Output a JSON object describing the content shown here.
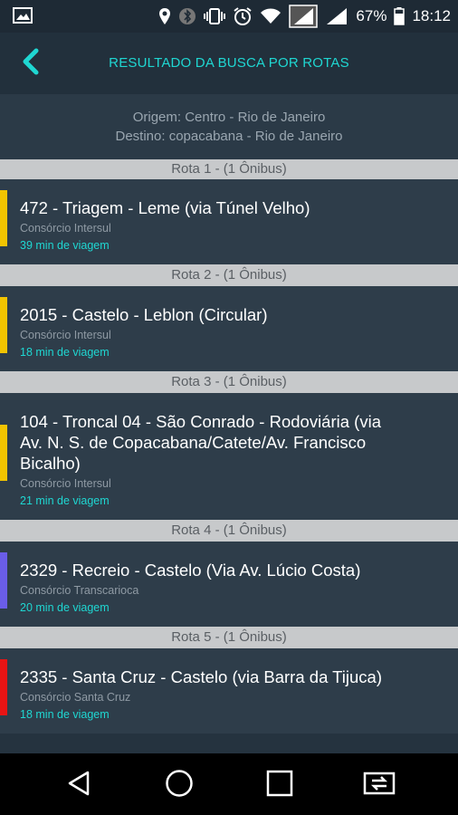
{
  "status_bar": {
    "battery_percent": "67%",
    "time": "18:12",
    "icons": [
      "image-icon",
      "location-icon",
      "bluetooth-icon",
      "vibrate-icon",
      "alarm-icon",
      "wifi-icon",
      "signal-icon",
      "signal-icon",
      "battery-icon"
    ]
  },
  "header": {
    "title": "RESULTADO DA BUSCA POR ROTAS",
    "back_icon": "chevron-left-icon",
    "accent_color": "#1fd7d2"
  },
  "search": {
    "origin": "Origem: Centro - Rio de Janeiro",
    "destination": "Destino: copacabana - Rio de Janeiro"
  },
  "routes": [
    {
      "header": "Rota 1 -  (1 Ônibus)",
      "line": "472 - Triagem - Leme (via Túnel Velho)",
      "operator": "Consórcio Intersul",
      "duration": "39 min de viagem",
      "color": "#f2c400"
    },
    {
      "header": "Rota 2 -  (1 Ônibus)",
      "line": "2015 - Castelo - Leblon (Circular)",
      "operator": "Consórcio Intersul",
      "duration": "18 min de viagem",
      "color": "#f2c400"
    },
    {
      "header": "Rota 3 -  (1 Ônibus)",
      "line": "104 - Troncal 04 - São Conrado - Rodoviária (via Av. N. S. de Copacabana/Catete/Av. Francisco Bicalho)",
      "operator": "Consórcio Intersul",
      "duration": "21 min de viagem",
      "color": "#f2c400"
    },
    {
      "header": "Rota 4 -  (1 Ônibus)",
      "line": "2329 - Recreio - Castelo (Via Av. Lúcio Costa)",
      "operator": "Consórcio Transcarioca",
      "duration": "20 min de viagem",
      "color": "#6a5de8"
    },
    {
      "header": "Rota 5 -  (1 Ônibus)",
      "line": "2335 - Santa Cruz - Castelo (via Barra da Tijuca)",
      "operator": "Consórcio Santa Cruz",
      "duration": "18 min de viagem",
      "color": "#e81414"
    }
  ],
  "nav": {
    "icons": [
      "back-triangle-icon",
      "home-circle-icon",
      "recents-square-icon",
      "screen-mirror-icon"
    ]
  }
}
